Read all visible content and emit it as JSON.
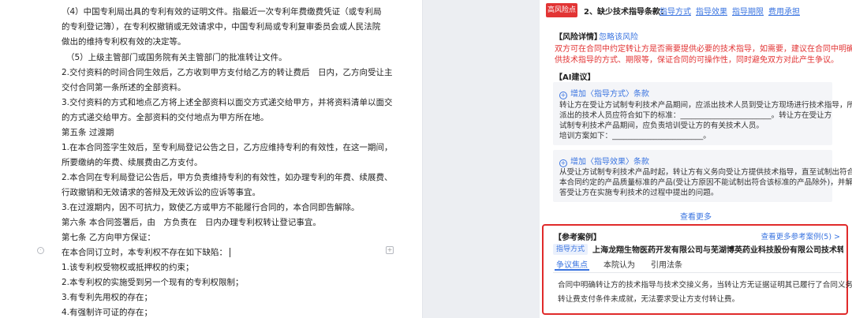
{
  "doc": {
    "lines": [
      "（4）中国专利局出具的专利有效的证明文件。指最近一次专利年费缴费凭证（或专利局",
      "的专利登记簿），在专利权撤销或无效请求中，中国专利局或专利复审委员会或人民法院",
      "做出的维持专利权有效的决定等。",
      "（5）上级主管部门或国务院有关主管部门的批准转让文件。",
      "2.交付资料的时间合同生效后，乙方收到甲方支付给乙方的转让费后　日内，乙方向受让主",
      "交付合同第一条所述的全部资料。",
      "3.交付资料的方式和地点乙方将上述全部资料以面交方式递交给甲方，并将资料清单以面交",
      "的方式递交给甲方。全部资料的交付地点为甲方所在地。",
      "第五条 过渡期",
      "1.在本合同签字生效后，至专利局登记公告之日，乙方应维持专利的有效性，在这一期间，",
      "所要缴纳的年费、续展费由乙方支付。",
      "2.本合同在专利局登记公告后，甲方负责维持专利的有效性，如办理专利的年费、续展费、",
      "行政撤销和无效请求的答辩及无效诉讼的应诉等事宜。",
      "3.在过渡期内，因不可抗力，致使乙方或甲方不能履行合同的，本合同即告解除。",
      "第六条 本合同签署后，由　方负责在　日内办理专利权转让登记事宜。",
      "第七条 乙方向甲方保证：",
      "在本合同订立时，本专利权不存在如下缺陷：",
      "1.该专利权受物权或抵押权的约束；",
      "2.本专利权的实施受到另一个现有的专利权限制；",
      "3.有专利先用权的存在；",
      "4.有强制许可证的存在；"
    ]
  },
  "panel": {
    "risk_tag": "高风险点",
    "risk_title": "2、缺少技术指导条款：",
    "risk_links": [
      "指导方式",
      "指导效果",
      "指导期限",
      "费用承担"
    ],
    "detail_heading": "【风险详情】",
    "detail_link": "忽略该风险",
    "detail_lines": [
      "双方可在合同中约定转让方是否需要提供必要的技术指导，如需要，建议在合同中明确约定提",
      "供技术指导的方式、期限等，保证合同的可操作性，同时避免双方对此产生争议。"
    ],
    "ai_heading": "【AI建议】",
    "suggestions": [
      {
        "title": "增加〈指导方式〉条款",
        "lines": [
          "转让方在受让方试制专利技术产品期间，应派出技术人员到受让方现场进行技术指导，所",
          "派出的技术人员应符合如下的标准：________________________。转让方在受让方",
          "试制专利技术产品期间，应负责培训受让方的有关技术人员。",
          "培训方案如下：________________________。"
        ]
      },
      {
        "title": "增加〈指导效果〉条款",
        "lines": [
          "从受让方试制专利技术产品时起，转让方有义务向受让方提供技术指导，直至试制出符合",
          "本合同约定的产品质量标准的产品(受让方原因不能试制出符合该标准的产品除外)，并解",
          "答受让方在实施专利技术的过程中提出的问题。"
        ]
      }
    ],
    "more_label": "查看更多",
    "case": {
      "heading": "【参考案例】",
      "more_link": "查看更多参考案例(5) >",
      "tag": "指导方式",
      "title": "上海龙翔生物医药开发有限公司与芜湖博英药业科技股份有限公司技术转让合同纠纷",
      "tabs": [
        "争议焦点",
        "本院认为",
        "引用法条"
      ],
      "content_lines": [
        "合同中明确转让方的技术指导与技术交接义务，当转让方无证据证明其已履行了合同义务时，",
        "转让费支付条件未成就，无法要求受让方支付转让费。"
      ]
    }
  },
  "colors": {
    "accent": "#3a74e0",
    "danger": "#e23434"
  }
}
